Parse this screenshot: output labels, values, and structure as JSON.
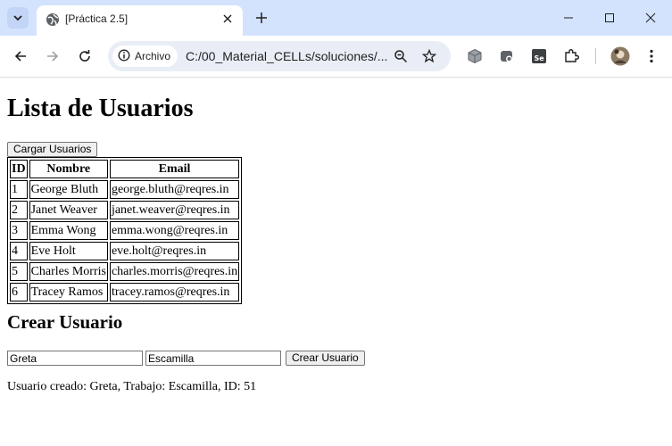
{
  "browser": {
    "tab_title": "[Práctica 2.5]",
    "site_chip_label": "Archivo",
    "url": "C:/00_Material_CELLs/soluciones/...",
    "icons": [
      "tab-search-icon",
      "globe-icon",
      "close-icon",
      "plus-icon",
      "minimize-icon",
      "maximize-icon",
      "close-window-icon",
      "back-arrow-icon",
      "forward-arrow-icon",
      "reload-icon",
      "info-icon",
      "zoom-icon",
      "star-icon",
      "extension-cube-icon",
      "extension-app-icon",
      "selenium-icon",
      "puzzle-icon",
      "profile-avatar",
      "kebab-menu-icon"
    ]
  },
  "page": {
    "title": "Lista de Usuarios",
    "load_button": "Cargar Usuarios",
    "table": {
      "headers": [
        "ID",
        "Nombre",
        "Email"
      ],
      "rows": [
        [
          "1",
          "George Bluth",
          "george.bluth@reqres.in"
        ],
        [
          "2",
          "Janet Weaver",
          "janet.weaver@reqres.in"
        ],
        [
          "3",
          "Emma Wong",
          "emma.wong@reqres.in"
        ],
        [
          "4",
          "Eve Holt",
          "eve.holt@reqres.in"
        ],
        [
          "5",
          "Charles Morris",
          "charles.morris@reqres.in"
        ],
        [
          "6",
          "Tracey Ramos",
          "tracey.ramos@reqres.in"
        ]
      ]
    },
    "create_title": "Crear Usuario",
    "name_value": "Greta",
    "job_value": "Escamilla",
    "create_button": "Crear Usuario",
    "result_text": "Usuario creado: Greta, Trabajo: Escamilla, ID: 51"
  }
}
